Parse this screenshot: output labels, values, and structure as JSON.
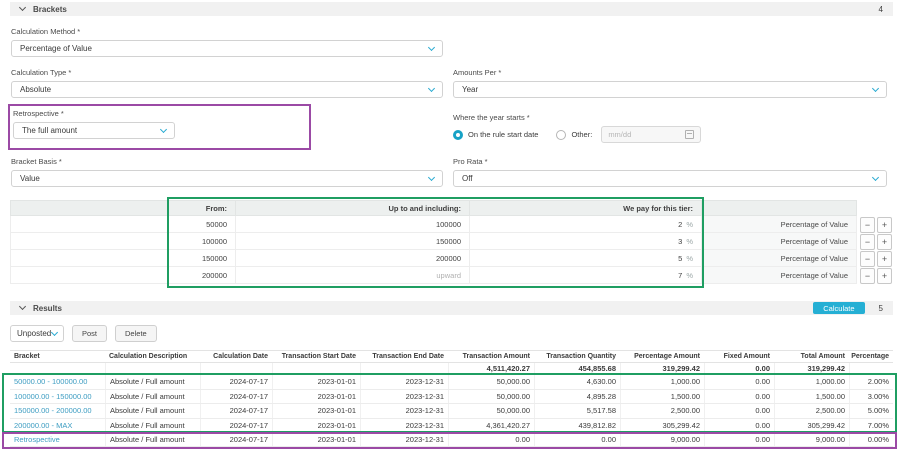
{
  "brackets": {
    "title": "Brackets",
    "count_badge": "4",
    "calculation_method": {
      "label": "Calculation Method *",
      "value": "Percentage of Value"
    },
    "calculation_type": {
      "label": "Calculation Type *",
      "value": "Absolute"
    },
    "amounts_per": {
      "label": "Amounts Per *",
      "value": "Year"
    },
    "retrospective": {
      "label": "Retrospective *",
      "value": "The full amount"
    },
    "year_starts": {
      "label": "Where the year starts *",
      "rule_start_option": "On the rule start date",
      "other_option": "Other:",
      "date_placeholder": "mm/dd"
    },
    "bracket_basis": {
      "label": "Bracket Basis *",
      "value": "Value"
    },
    "pro_rata": {
      "label": "Pro Rata *",
      "value": "Off"
    },
    "tiers": {
      "from_header": "From:",
      "up_to_header": "Up to and including:",
      "we_pay_header": "We pay for this tier:",
      "percent_sign": "%",
      "decrease_label": "−",
      "increase_label": "+",
      "rows": [
        {
          "from": "50000",
          "up_to": "100000",
          "we_pay": "2",
          "method": "Percentage of Value"
        },
        {
          "from": "100000",
          "up_to": "150000",
          "we_pay": "3",
          "method": "Percentage of Value"
        },
        {
          "from": "150000",
          "up_to": "200000",
          "we_pay": "5",
          "method": "Percentage of Value"
        },
        {
          "from": "200000",
          "up_to": "upward",
          "we_pay": "7",
          "method": "Percentage of Value"
        }
      ]
    }
  },
  "results": {
    "title": "Results",
    "count_badge": "5",
    "calculate_button": "Calculate",
    "status_filter": "Unposted",
    "post_button": "Post",
    "delete_button": "Delete",
    "table": {
      "headers": [
        "Bracket",
        "Calculation Description",
        "Calculation Date",
        "Transaction Start Date",
        "Transaction End Date",
        "Transaction Amount",
        "Transaction Quantity",
        "Percentage Amount",
        "Fixed Amount",
        "Total Amount",
        "Percentage"
      ],
      "totals": {
        "transaction_amount": "4,511,420.27",
        "transaction_quantity": "454,855.68",
        "percentage_amount": "319,299.42",
        "fixed_amount": "0.00",
        "total_amount": "319,299.42"
      },
      "rows": [
        {
          "bracket": "50000.00 - 100000.00",
          "description": "Absolute / Full amount",
          "calculation_date": "2024-07-17",
          "start_date": "2023-01-01",
          "end_date": "2023-12-31",
          "transaction_amount": "50,000.00",
          "transaction_quantity": "4,630.00",
          "percentage_amount": "1,000.00",
          "fixed_amount": "0.00",
          "total_amount": "1,000.00",
          "percentage": "2.00%"
        },
        {
          "bracket": "100000.00 - 150000.00",
          "description": "Absolute / Full amount",
          "calculation_date": "2024-07-17",
          "start_date": "2023-01-01",
          "end_date": "2023-12-31",
          "transaction_amount": "50,000.00",
          "transaction_quantity": "4,895.28",
          "percentage_amount": "1,500.00",
          "fixed_amount": "0.00",
          "total_amount": "1,500.00",
          "percentage": "3.00%"
        },
        {
          "bracket": "150000.00 - 200000.00",
          "description": "Absolute / Full amount",
          "calculation_date": "2024-07-17",
          "start_date": "2023-01-01",
          "end_date": "2023-12-31",
          "transaction_amount": "50,000.00",
          "transaction_quantity": "5,517.58",
          "percentage_amount": "2,500.00",
          "fixed_amount": "0.00",
          "total_amount": "2,500.00",
          "percentage": "5.00%"
        },
        {
          "bracket": "200000.00 - MAX",
          "description": "Absolute / Full amount",
          "calculation_date": "2024-07-17",
          "start_date": "2023-01-01",
          "end_date": "2023-12-31",
          "transaction_amount": "4,361,420.27",
          "transaction_quantity": "439,812.82",
          "percentage_amount": "305,299.42",
          "fixed_amount": "0.00",
          "total_amount": "305,299.42",
          "percentage": "7.00%"
        },
        {
          "bracket": "Retrospective",
          "description": "Absolute / Full amount",
          "calculation_date": "2024-07-17",
          "start_date": "2023-01-01",
          "end_date": "2023-12-31",
          "transaction_amount": "0.00",
          "transaction_quantity": "0.00",
          "percentage_amount": "9,000.00",
          "fixed_amount": "0.00",
          "total_amount": "9,000.00",
          "percentage": "0.00%"
        }
      ]
    }
  },
  "colors": {
    "accent_cyan": "#25afd4",
    "link_blue": "#3d9dc2",
    "highlight_green": "#1f9e62",
    "highlight_purple": "#9b4aa5"
  }
}
